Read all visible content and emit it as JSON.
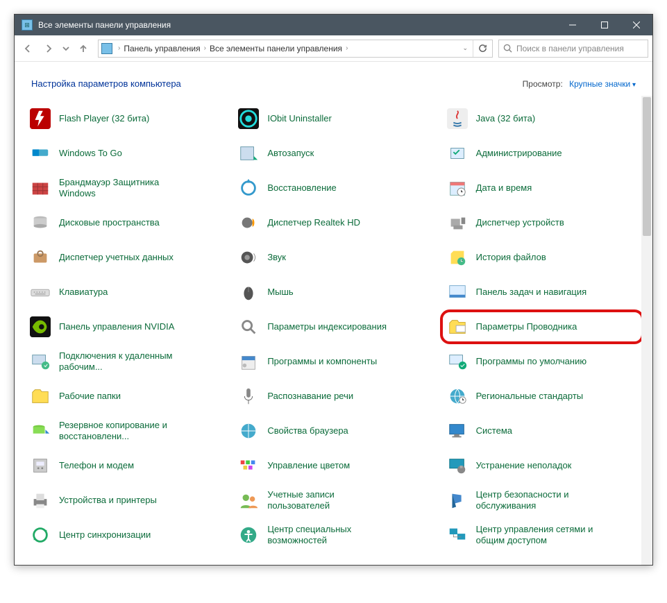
{
  "title": "Все элементы панели управления",
  "breadcrumbs": [
    "Панель управления",
    "Все элементы панели управления"
  ],
  "search_placeholder": "Поиск в панели управления",
  "heading": "Настройка параметров компьютера",
  "view_label": "Просмотр:",
  "view_value": "Крупные значки",
  "items": [
    {
      "label": "Flash Player (32 бита)",
      "icon": "flash"
    },
    {
      "label": "IObit Uninstaller",
      "icon": "iobit"
    },
    {
      "label": "Java (32 бита)",
      "icon": "java"
    },
    {
      "label": "Windows To Go",
      "icon": "wtg"
    },
    {
      "label": "Автозапуск",
      "icon": "autoplay"
    },
    {
      "label": "Администрирование",
      "icon": "admin"
    },
    {
      "label": "Брандмауэр Защитника Windows",
      "icon": "firewall"
    },
    {
      "label": "Восстановление",
      "icon": "recovery"
    },
    {
      "label": "Дата и время",
      "icon": "datetime"
    },
    {
      "label": "Дисковые пространства",
      "icon": "storage"
    },
    {
      "label": "Диспетчер Realtek HD",
      "icon": "realtek"
    },
    {
      "label": "Диспетчер устройств",
      "icon": "devmgr"
    },
    {
      "label": "Диспетчер учетных данных",
      "icon": "cred"
    },
    {
      "label": "Звук",
      "icon": "sound"
    },
    {
      "label": "История файлов",
      "icon": "filehist"
    },
    {
      "label": "Клавиатура",
      "icon": "keyboard"
    },
    {
      "label": "Мышь",
      "icon": "mouse"
    },
    {
      "label": "Панель задач и навигация",
      "icon": "taskbar"
    },
    {
      "label": "Панель управления NVIDIA",
      "icon": "nvidia"
    },
    {
      "label": "Параметры индексирования",
      "icon": "index"
    },
    {
      "label": "Параметры Проводника",
      "icon": "explorer",
      "hl": true
    },
    {
      "label": "Подключения к удаленным рабочим...",
      "icon": "rdp"
    },
    {
      "label": "Программы и компоненты",
      "icon": "programs"
    },
    {
      "label": "Программы по умолчанию",
      "icon": "defaults"
    },
    {
      "label": "Рабочие папки",
      "icon": "workfolders"
    },
    {
      "label": "Распознавание речи",
      "icon": "speech"
    },
    {
      "label": "Региональные стандарты",
      "icon": "region"
    },
    {
      "label": "Резервное копирование и восстановлени...",
      "icon": "backup"
    },
    {
      "label": "Свойства браузера",
      "icon": "inetopt"
    },
    {
      "label": "Система",
      "icon": "system"
    },
    {
      "label": "Телефон и модем",
      "icon": "phone"
    },
    {
      "label": "Управление цветом",
      "icon": "color"
    },
    {
      "label": "Устранение неполадок",
      "icon": "trouble"
    },
    {
      "label": "Устройства и принтеры",
      "icon": "printers"
    },
    {
      "label": "Учетные записи пользователей",
      "icon": "users"
    },
    {
      "label": "Центр безопасности и обслуживания",
      "icon": "security"
    },
    {
      "label": "Центр синхронизации",
      "icon": "sync"
    },
    {
      "label": "Центр специальных возможностей",
      "icon": "ease"
    },
    {
      "label": "Центр управления сетями и общим доступом",
      "icon": "network"
    }
  ]
}
